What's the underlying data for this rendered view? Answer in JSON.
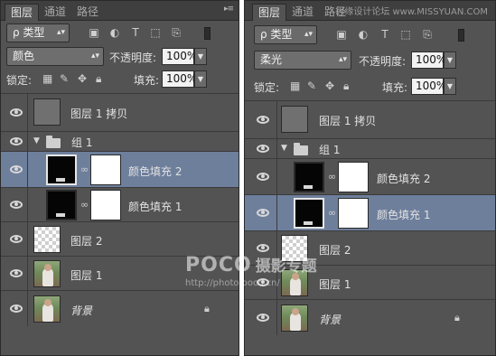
{
  "watermark_top": "思缘设计论坛 www.MISSYUAN.COM",
  "poco": {
    "brand": "POCO",
    "title": "摄影专题",
    "url": "http://photo.poco.cn/"
  },
  "panels": [
    {
      "tabs": [
        "图层",
        "通道",
        "路径"
      ],
      "filter_kind": "ρ 类型",
      "blend_mode": "颜色",
      "opacity_label": "不透明度:",
      "opacity_value": "100%",
      "lock_label": "锁定:",
      "fill_label": "填充:",
      "fill_value": "100%",
      "layers": [
        {
          "name": "图层 1 拷贝"
        },
        {
          "name": "组 1"
        },
        {
          "name": "颜色填充 2"
        },
        {
          "name": "颜色填充 1"
        },
        {
          "name": "图层 2"
        },
        {
          "name": "图层 1"
        },
        {
          "name": "背景"
        }
      ],
      "selected": "颜色填充 2"
    },
    {
      "tabs": [
        "图层",
        "通道",
        "路径"
      ],
      "filter_kind": "ρ 类型",
      "blend_mode": "柔光",
      "opacity_label": "不透明度:",
      "opacity_value": "100%",
      "lock_label": "锁定:",
      "fill_label": "填充:",
      "fill_value": "100%",
      "layers": [
        {
          "name": "图层 1 拷贝"
        },
        {
          "name": "组 1"
        },
        {
          "name": "颜色填充 2"
        },
        {
          "name": "颜色填充 1"
        },
        {
          "name": "图层 2"
        },
        {
          "name": "图层 1"
        },
        {
          "name": "背景"
        }
      ],
      "selected": "颜色填充 1"
    }
  ],
  "icons": {
    "filter": [
      "image-filter-icon",
      "adjustment-filter-icon",
      "type-filter-icon",
      "shape-filter-icon",
      "smart-object-filter-icon"
    ],
    "lock": [
      "lock-transparent-icon",
      "lock-pixels-icon",
      "lock-position-icon",
      "lock-all-icon"
    ]
  },
  "colors": {
    "panel_bg": "#535353",
    "selected_row": "#6e7f9c",
    "tab_bar": "#3f3f3f"
  }
}
